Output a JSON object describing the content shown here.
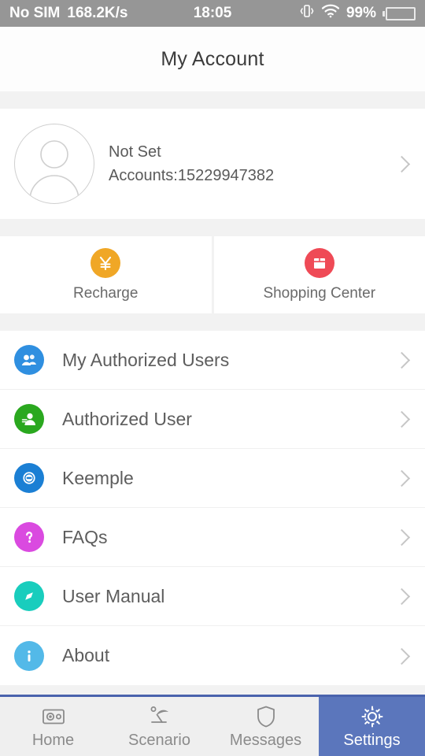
{
  "status_bar": {
    "carrier": "No SIM",
    "network_speed": "168.2K/s",
    "time": "18:05",
    "vibrate_icon": "vibrate-icon",
    "wifi_icon": "wifi-icon",
    "battery_percent": "99%"
  },
  "header": {
    "title": "My Account"
  },
  "profile": {
    "avatar_icon": "person-avatar-icon",
    "name": "Not Set",
    "account": "Accounts:15229947382",
    "chevron_icon": "chevron-right-icon"
  },
  "tiles": [
    {
      "label": "Recharge",
      "icon": "yen-coin-icon",
      "color": "#f0a726"
    },
    {
      "label": "Shopping Center",
      "icon": "shop-icon",
      "color": "#ef4a56"
    }
  ],
  "menu": [
    {
      "label": "My Authorized Users",
      "icon": "users-group-icon",
      "color": "#2f8fe0"
    },
    {
      "label": "Authorized User",
      "icon": "user-person-icon",
      "color": "#2aa81f"
    },
    {
      "label": "Keemple",
      "icon": "keemple-logo-icon",
      "color": "#1b7fd4"
    },
    {
      "label": "FAQs",
      "icon": "question-mark-icon",
      "color": "#da4ae0"
    },
    {
      "label": "User Manual",
      "icon": "compass-icon",
      "color": "#19cdbd"
    },
    {
      "label": "About",
      "icon": "info-icon",
      "color": "#53b9e8"
    }
  ],
  "tabbar": {
    "active_color": "#5b76bc",
    "items": [
      {
        "label": "Home",
        "icon": "camera-icon",
        "active": false
      },
      {
        "label": "Scenario",
        "icon": "beach-umbrella-icon",
        "active": false
      },
      {
        "label": "Messages",
        "icon": "shield-icon",
        "active": false
      },
      {
        "label": "Settings",
        "icon": "gear-icon",
        "active": true
      }
    ]
  }
}
